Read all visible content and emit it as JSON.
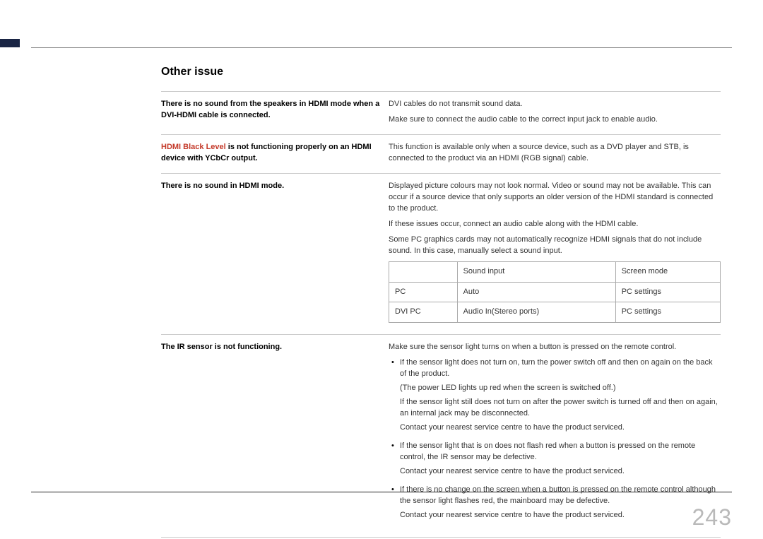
{
  "page_number": "243",
  "section_title": "Other issue",
  "rows": [
    {
      "issue": "There is no sound from the speakers in HDMI mode when a DVI-HDMI cable is connected.",
      "answer": [
        "DVI cables do not transmit sound data.",
        "Make sure to connect the audio cable to the correct input jack to enable audio."
      ]
    },
    {
      "issue_red": "HDMI Black Level",
      "issue_rest": " is not functioning properly on an HDMI device with YCbCr output.",
      "answer": [
        "This function is available only when a source device, such as a DVD player and STB, is connected to the product via an HDMI (RGB signal) cable."
      ]
    },
    {
      "issue": "There is no sound in HDMI mode.",
      "answer_pre": [
        "Displayed picture colours may not look normal. Video or sound may not be available. This can occur if a source device that only supports an older version of the HDMI standard is connected to the product.",
        "If these issues occur, connect an audio cable along with the HDMI cable.",
        "Some PC graphics cards may not automatically recognize HDMI signals that do not include sound. In this case, manually select a sound input."
      ],
      "table": {
        "header": [
          "",
          "Sound input",
          "Screen mode"
        ],
        "rows": [
          [
            "PC",
            "Auto",
            "PC settings"
          ],
          [
            "DVI PC",
            "Audio In(Stereo ports)",
            "PC settings"
          ]
        ]
      }
    },
    {
      "issue": "The IR sensor is not functioning.",
      "answer_pre": [
        "Make sure the sensor light turns on when a button is pressed on the remote control."
      ],
      "bullets": [
        {
          "main": "If the sensor light does not turn on, turn the power switch off and then on again on the back of the product.",
          "subs": [
            "(The power LED lights up red when the screen is switched off.)",
            "If the sensor light still does not turn on after the power switch is turned off and then on again, an internal jack may be disconnected.",
            "Contact your nearest service centre to have the product serviced."
          ]
        },
        {
          "main": "If the sensor light that is on does not flash red when a button is pressed on the remote control, the IR sensor may be defective.",
          "subs": [
            "Contact your nearest service centre to have the product serviced."
          ]
        },
        {
          "main": "If there is no change on the screen when a button is pressed on the remote control although the sensor light flashes red, the mainboard may be defective.",
          "subs": [
            "Contact your nearest service centre to have the product serviced."
          ]
        }
      ]
    }
  ]
}
